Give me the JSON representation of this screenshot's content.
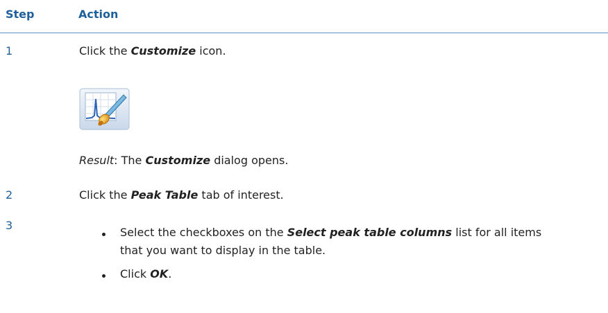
{
  "header": {
    "step_label": "Step",
    "action_label": "Action"
  },
  "steps": [
    {
      "number": "1",
      "pre": "Click the ",
      "bold": "Customize",
      "post": " icon.",
      "icon_name": "customize-icon",
      "result_label": "Result",
      "result_pre": ": The ",
      "result_bold": "Customize",
      "result_post": " dialog opens."
    },
    {
      "number": "2",
      "pre": "Click the ",
      "bold": "Peak Table",
      "post": " tab of interest."
    },
    {
      "number": "3",
      "bullets": [
        {
          "pre": "Select the checkboxes on the ",
          "bold": "Select peak table columns",
          "post": " list for all items",
          "line2": "that you want to display in the table."
        },
        {
          "pre": "Click ",
          "bold": "OK",
          "post": "."
        }
      ]
    }
  ],
  "colors": {
    "heading": "#1f5f9a",
    "rule": "#5b8fbf",
    "text": "#222222"
  }
}
